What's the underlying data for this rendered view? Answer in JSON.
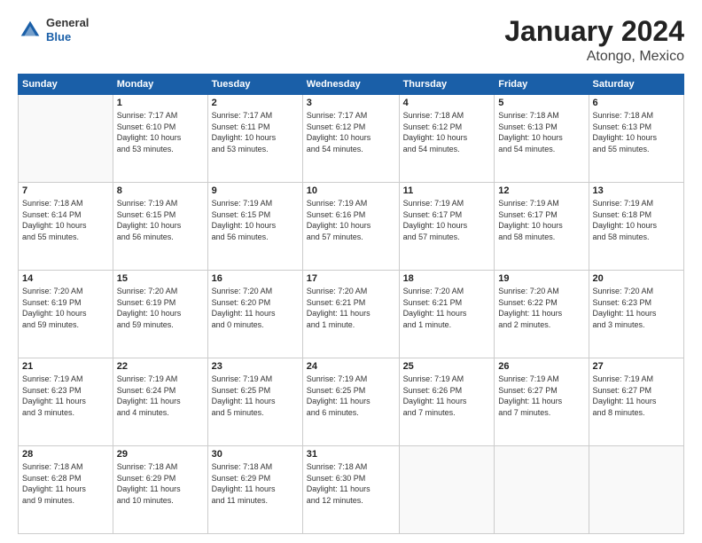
{
  "header": {
    "logo": {
      "line1": "General",
      "line2": "Blue"
    },
    "title": "January 2024",
    "subtitle": "Atongo, Mexico"
  },
  "weekdays": [
    "Sunday",
    "Monday",
    "Tuesday",
    "Wednesday",
    "Thursday",
    "Friday",
    "Saturday"
  ],
  "weeks": [
    [
      {
        "day": "",
        "info": ""
      },
      {
        "day": "1",
        "info": "Sunrise: 7:17 AM\nSunset: 6:10 PM\nDaylight: 10 hours\nand 53 minutes."
      },
      {
        "day": "2",
        "info": "Sunrise: 7:17 AM\nSunset: 6:11 PM\nDaylight: 10 hours\nand 53 minutes."
      },
      {
        "day": "3",
        "info": "Sunrise: 7:17 AM\nSunset: 6:12 PM\nDaylight: 10 hours\nand 54 minutes."
      },
      {
        "day": "4",
        "info": "Sunrise: 7:18 AM\nSunset: 6:12 PM\nDaylight: 10 hours\nand 54 minutes."
      },
      {
        "day": "5",
        "info": "Sunrise: 7:18 AM\nSunset: 6:13 PM\nDaylight: 10 hours\nand 54 minutes."
      },
      {
        "day": "6",
        "info": "Sunrise: 7:18 AM\nSunset: 6:13 PM\nDaylight: 10 hours\nand 55 minutes."
      }
    ],
    [
      {
        "day": "7",
        "info": "Sunrise: 7:18 AM\nSunset: 6:14 PM\nDaylight: 10 hours\nand 55 minutes."
      },
      {
        "day": "8",
        "info": "Sunrise: 7:19 AM\nSunset: 6:15 PM\nDaylight: 10 hours\nand 56 minutes."
      },
      {
        "day": "9",
        "info": "Sunrise: 7:19 AM\nSunset: 6:15 PM\nDaylight: 10 hours\nand 56 minutes."
      },
      {
        "day": "10",
        "info": "Sunrise: 7:19 AM\nSunset: 6:16 PM\nDaylight: 10 hours\nand 57 minutes."
      },
      {
        "day": "11",
        "info": "Sunrise: 7:19 AM\nSunset: 6:17 PM\nDaylight: 10 hours\nand 57 minutes."
      },
      {
        "day": "12",
        "info": "Sunrise: 7:19 AM\nSunset: 6:17 PM\nDaylight: 10 hours\nand 58 minutes."
      },
      {
        "day": "13",
        "info": "Sunrise: 7:19 AM\nSunset: 6:18 PM\nDaylight: 10 hours\nand 58 minutes."
      }
    ],
    [
      {
        "day": "14",
        "info": "Sunrise: 7:20 AM\nSunset: 6:19 PM\nDaylight: 10 hours\nand 59 minutes."
      },
      {
        "day": "15",
        "info": "Sunrise: 7:20 AM\nSunset: 6:19 PM\nDaylight: 10 hours\nand 59 minutes."
      },
      {
        "day": "16",
        "info": "Sunrise: 7:20 AM\nSunset: 6:20 PM\nDaylight: 11 hours\nand 0 minutes."
      },
      {
        "day": "17",
        "info": "Sunrise: 7:20 AM\nSunset: 6:21 PM\nDaylight: 11 hours\nand 1 minute."
      },
      {
        "day": "18",
        "info": "Sunrise: 7:20 AM\nSunset: 6:21 PM\nDaylight: 11 hours\nand 1 minute."
      },
      {
        "day": "19",
        "info": "Sunrise: 7:20 AM\nSunset: 6:22 PM\nDaylight: 11 hours\nand 2 minutes."
      },
      {
        "day": "20",
        "info": "Sunrise: 7:20 AM\nSunset: 6:23 PM\nDaylight: 11 hours\nand 3 minutes."
      }
    ],
    [
      {
        "day": "21",
        "info": "Sunrise: 7:19 AM\nSunset: 6:23 PM\nDaylight: 11 hours\nand 3 minutes."
      },
      {
        "day": "22",
        "info": "Sunrise: 7:19 AM\nSunset: 6:24 PM\nDaylight: 11 hours\nand 4 minutes."
      },
      {
        "day": "23",
        "info": "Sunrise: 7:19 AM\nSunset: 6:25 PM\nDaylight: 11 hours\nand 5 minutes."
      },
      {
        "day": "24",
        "info": "Sunrise: 7:19 AM\nSunset: 6:25 PM\nDaylight: 11 hours\nand 6 minutes."
      },
      {
        "day": "25",
        "info": "Sunrise: 7:19 AM\nSunset: 6:26 PM\nDaylight: 11 hours\nand 7 minutes."
      },
      {
        "day": "26",
        "info": "Sunrise: 7:19 AM\nSunset: 6:27 PM\nDaylight: 11 hours\nand 7 minutes."
      },
      {
        "day": "27",
        "info": "Sunrise: 7:19 AM\nSunset: 6:27 PM\nDaylight: 11 hours\nand 8 minutes."
      }
    ],
    [
      {
        "day": "28",
        "info": "Sunrise: 7:18 AM\nSunset: 6:28 PM\nDaylight: 11 hours\nand 9 minutes."
      },
      {
        "day": "29",
        "info": "Sunrise: 7:18 AM\nSunset: 6:29 PM\nDaylight: 11 hours\nand 10 minutes."
      },
      {
        "day": "30",
        "info": "Sunrise: 7:18 AM\nSunset: 6:29 PM\nDaylight: 11 hours\nand 11 minutes."
      },
      {
        "day": "31",
        "info": "Sunrise: 7:18 AM\nSunset: 6:30 PM\nDaylight: 11 hours\nand 12 minutes."
      },
      {
        "day": "",
        "info": ""
      },
      {
        "day": "",
        "info": ""
      },
      {
        "day": "",
        "info": ""
      }
    ]
  ]
}
